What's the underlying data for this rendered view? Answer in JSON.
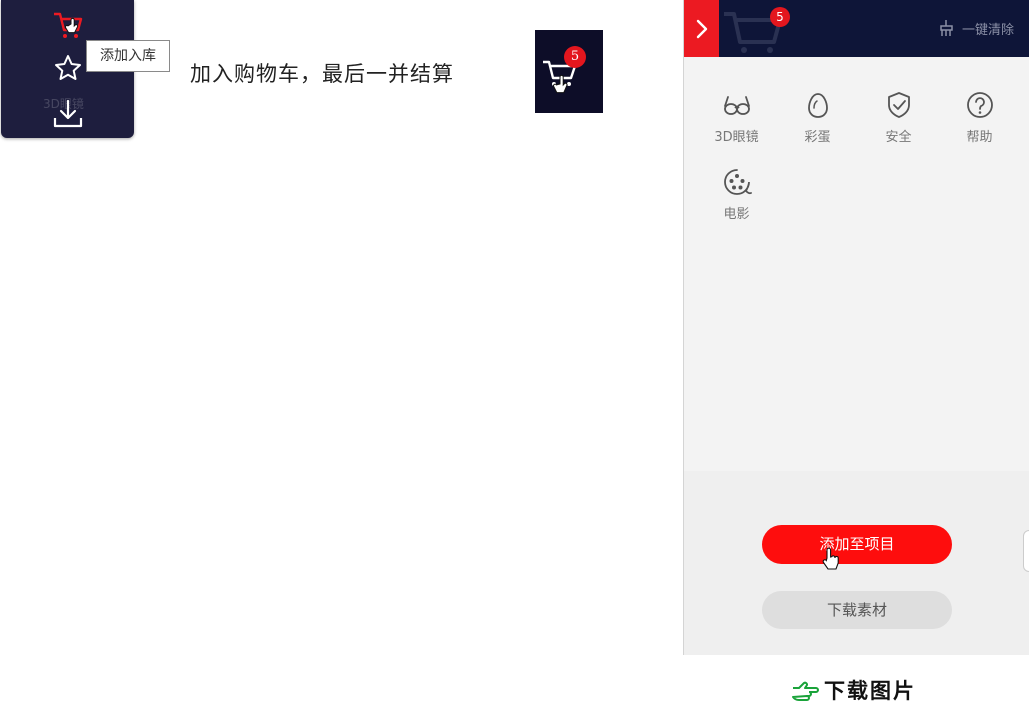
{
  "hover_panel": {
    "tooltip": "添加入库",
    "ghost_label": "3D眼镜",
    "icons": [
      "cart-icon",
      "star-icon",
      "download-icon"
    ]
  },
  "caption": "加入购物车，最后一并结算",
  "thumb_badge": "5",
  "drawer": {
    "badge_count": "5",
    "clear_label": "一键清除",
    "tools": [
      {
        "label": "3D眼镜",
        "icon": "glasses-icon"
      },
      {
        "label": "彩蛋",
        "icon": "egg-icon"
      },
      {
        "label": "安全",
        "icon": "shield-icon"
      },
      {
        "label": "帮助",
        "icon": "help-icon"
      },
      {
        "label": "电影",
        "icon": "film-reel-icon"
      }
    ],
    "add_to_project": "添加至项目",
    "download_assets": "下载素材"
  },
  "footer": {
    "download_image": "下载图片"
  },
  "colors": {
    "accent_red": "#ec1a22",
    "header_navy": "#0e1538",
    "panel_dark": "#1e1e3e",
    "link_green": "#1aa33a"
  }
}
